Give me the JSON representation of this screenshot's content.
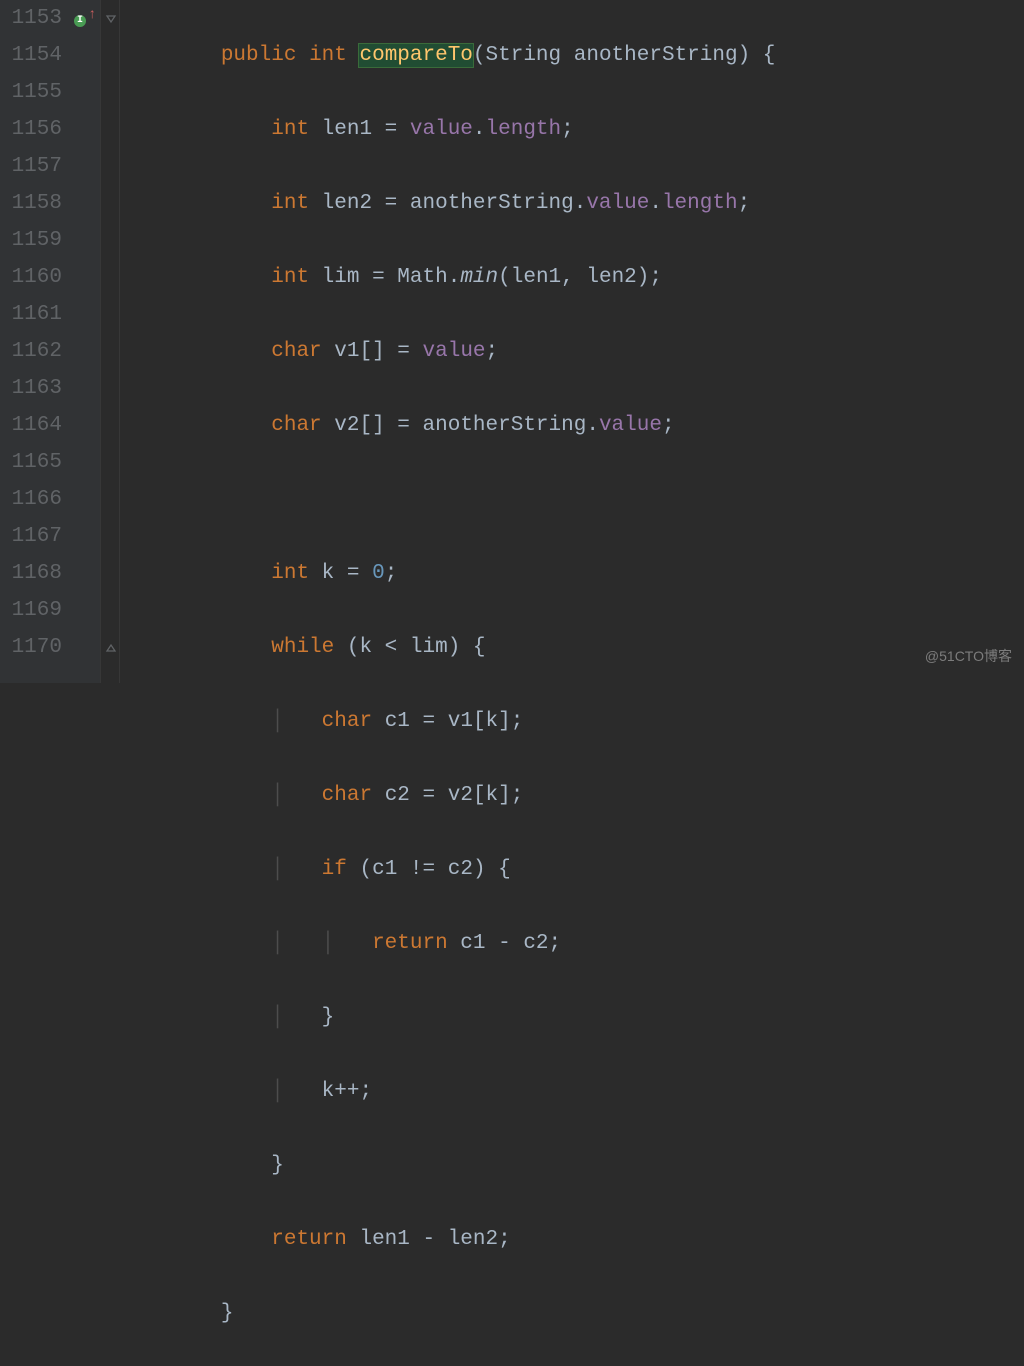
{
  "watermark": "@51CTO博客",
  "gutter": {
    "l1153": "1153",
    "l1154": "1154",
    "l1155": "1155",
    "l1156": "1156",
    "l1157": "1157",
    "l1158": "1158",
    "l1159": "1159",
    "l1160": "1160",
    "l1161": "1161",
    "l1162": "1162",
    "l1163": "1163",
    "l1164": "1164",
    "l1165": "1165",
    "l1166": "1166",
    "l1167": "1167",
    "l1168": "1168",
    "l1169": "1169",
    "l1170": "1170"
  },
  "marks": {
    "implements": "I",
    "at": "@"
  },
  "tokens": {
    "kw_public": "public",
    "kw_int": "int",
    "kw_char": "char",
    "kw_while": "while",
    "kw_if": "if",
    "kw_return": "return",
    "fn_compareTo": "compareTo",
    "ty_String": "String",
    "p_anotherString": "anotherString",
    "v_len1": "len1",
    "v_len2": "len2",
    "v_lim": "lim",
    "v_v1": "v1",
    "v_v2": "v2",
    "v_k": "k",
    "v_c1": "c1",
    "v_c2": "c2",
    "f_value": "value",
    "f_length": "length",
    "cls_Math": "Math",
    "m_min": "min",
    "num_0": "0",
    "op_eq": " = ",
    "op_dot": ".",
    "op_semi": ";",
    "op_lp": "(",
    "op_rp": ")",
    "op_lb": "[",
    "op_rb": "]",
    "op_lc": " {",
    "op_rc": "}",
    "op_lt": " < ",
    "op_ne": " != ",
    "op_minus": " - ",
    "op_inc": "++",
    "op_comma": ", ",
    "sp1": "        ",
    "sp2": "            ",
    "sp3": "                ",
    "sp4": "                    "
  }
}
